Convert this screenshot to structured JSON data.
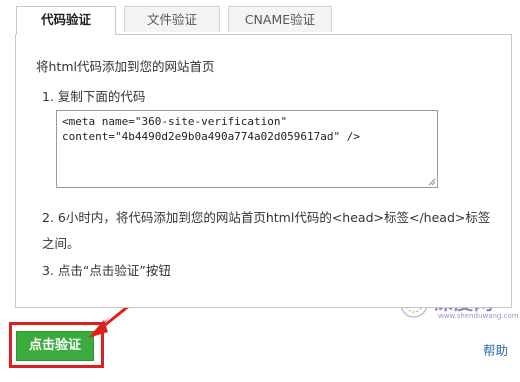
{
  "tabs": [
    {
      "label": "代码验证",
      "active": true
    },
    {
      "label": "文件验证",
      "active": false
    },
    {
      "label": "CNAME验证",
      "active": false
    }
  ],
  "instruction": "将html代码添加到您的网站首页",
  "steps": {
    "s1": "1. 复制下面的代码",
    "code_line1": "<meta name=\"360-site-verification\"",
    "code_line2": "content=\"4b4490d2e9b0a490a774a02d059617ad\" />",
    "s2": "2. 6小时内，将代码添加到您的网站首页html代码的<head>标签</head>标签之间。",
    "s3": "3. 点击“点击验证”按钮"
  },
  "buttons": {
    "verify": "点击验证",
    "help": "帮助"
  },
  "watermark": {
    "text": "深度网",
    "sub": "www.shenduwang.com"
  },
  "colors": {
    "verify_green": "#3cab3d",
    "highlight_red": "#e02020",
    "link_blue": "#2a6ab5"
  }
}
